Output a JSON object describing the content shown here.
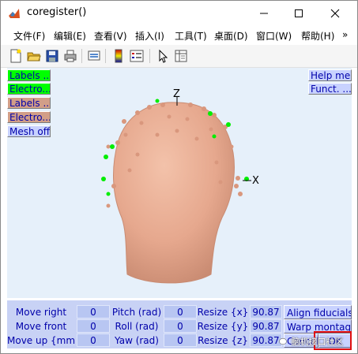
{
  "window": {
    "title": "coregister()",
    "controls": {
      "minimize": "—",
      "maximize": "☐",
      "close": "✕"
    }
  },
  "menubar": {
    "items": [
      {
        "label": "文件(F)"
      },
      {
        "label": "编辑(E)"
      },
      {
        "label": "查看(V)"
      },
      {
        "label": "插入(I)"
      },
      {
        "label": "工具(T)"
      },
      {
        "label": "桌面(D)"
      },
      {
        "label": "窗口(W)"
      },
      {
        "label": "帮助(H)"
      }
    ],
    "overflow": "»"
  },
  "toolbar": {
    "icons": [
      "new-figure-icon",
      "open-file-icon",
      "save-icon",
      "print-icon",
      "link-icon",
      "colorbar-icon",
      "legend-icon",
      "pointer-icon",
      "property-inspector-icon"
    ]
  },
  "figure": {
    "left_buttons": [
      {
        "label": "Labels ...",
        "color": "#00ff00"
      },
      {
        "label": "Electro...",
        "color": "#00ff00"
      },
      {
        "label": "Labels ...",
        "color": "#d29e88"
      },
      {
        "label": "Electro...",
        "color": "#d29e88"
      },
      {
        "label": "Mesh off",
        "color": "#c8d2ff"
      }
    ],
    "right_buttons": [
      {
        "label": "Help me"
      },
      {
        "label": "Funct. ..."
      }
    ],
    "axes": {
      "z_label": "Z",
      "x_label": "X"
    },
    "colors": {
      "background": "#e6f0fa",
      "head": "#e8a98f",
      "electrodes_green": "#00ee00",
      "electrodes_tan": "#c98f78"
    }
  },
  "controls": {
    "rows": [
      {
        "move_label": "Move right",
        "move_value": "0",
        "rot_label": "Pitch (rad)",
        "rot_value": "0",
        "resize_label": "Resize {x}",
        "resize_value": "90.87",
        "action": "Align fiducials"
      },
      {
        "move_label": "Move front",
        "move_value": "0",
        "rot_label": "Roll (rad)",
        "rot_value": "0",
        "resize_label": "Resize {y}",
        "resize_value": "90.87",
        "action": "Warp montage"
      },
      {
        "move_label": "Move up {mm}",
        "move_value": "0",
        "rot_label": "Yaw (rad)",
        "rot_value": "0",
        "resize_label": "Resize {z}",
        "resize_value": "90.87",
        "action": "Cancel"
      }
    ],
    "ok_label": "OK",
    "panel_color": "#c8d2f5"
  },
  "watermark": "脑机接口社区"
}
